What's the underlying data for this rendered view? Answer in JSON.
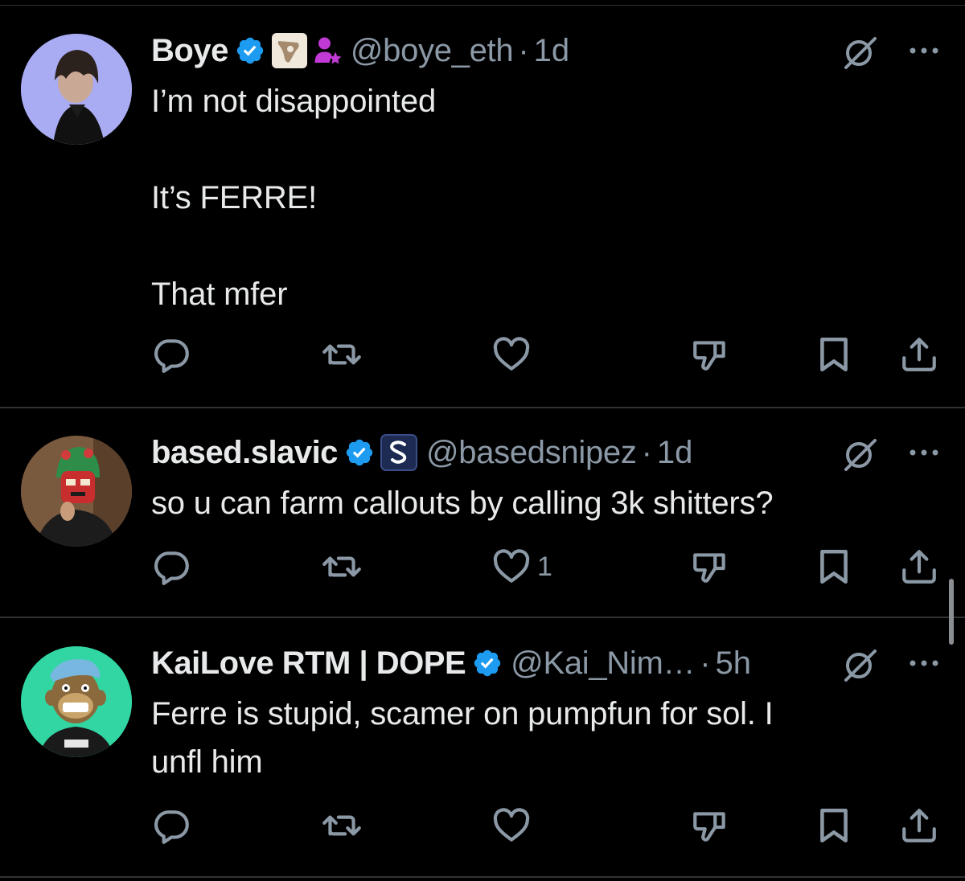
{
  "tweets": [
    {
      "name": "Boye",
      "handle": "@boye_eth",
      "separator": "·",
      "time": "1d",
      "text": "I’m not disappointed\n\nIt’s FERRE!\n\nThat mfer",
      "likes": "",
      "avatar_color": "#a7a9f2",
      "badges": [
        "verified-icon",
        "affiliate-badge-icon",
        "subscriber-badge-icon"
      ]
    },
    {
      "name": "based.slavic",
      "handle": "@basedsnipez",
      "separator": "·",
      "time": "1d",
      "text": "so u can farm callouts by calling 3k shitters?",
      "likes": "1",
      "avatar_color": "#6b4a34",
      "badges": [
        "verified-icon",
        "affiliate-badge-icon"
      ]
    },
    {
      "name": "KaiLove RTM | DOPE",
      "handle": "@Kai_Nim…",
      "separator": "·",
      "time": "5h",
      "text": "Ferre is stupid, scamer on pumpfun for sol. I\nunfl him",
      "likes": "",
      "avatar_color": "#2ed3a0",
      "badges": [
        "verified-icon"
      ]
    }
  ],
  "colors": {
    "background": "#000000",
    "text": "#e7e9ea",
    "secondary": "#8b98a5",
    "verified": "#1d9bf0",
    "divider": "#2f3336"
  },
  "icons": [
    "reply-icon",
    "retweet-icon",
    "like-icon",
    "dislike-icon",
    "bookmark-icon",
    "share-icon",
    "grok-icon",
    "more-icon"
  ]
}
